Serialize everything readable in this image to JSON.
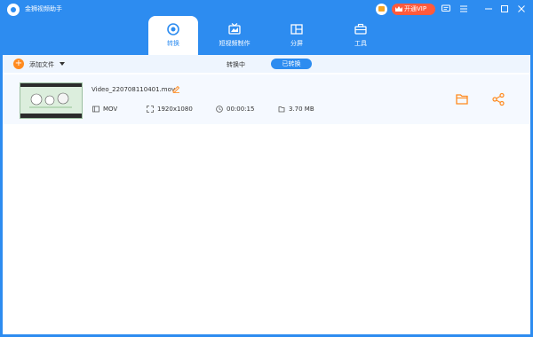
{
  "app": {
    "title": "金狮视频助手"
  },
  "titlebar": {
    "vip_label": "开通VIP",
    "icons": [
      "gift-icon",
      "crown-icon",
      "chat-icon",
      "menu-icon",
      "minimize-icon",
      "maximize-icon",
      "close-icon"
    ]
  },
  "tabs": [
    {
      "label": "转换",
      "icon": "convert-icon",
      "active": true
    },
    {
      "label": "短视频制作",
      "icon": "short-video-icon",
      "active": false
    },
    {
      "label": "分屏",
      "icon": "split-screen-icon",
      "active": false
    },
    {
      "label": "工具",
      "icon": "toolbox-icon",
      "active": false
    }
  ],
  "toolbar": {
    "add_label": "添加文件",
    "seg_converting": "转换中",
    "seg_done": "已转换"
  },
  "file": {
    "name": "Video_220708110401.mov",
    "format": "MOV",
    "resolution": "1920x1080",
    "duration": "00:00:15",
    "size": "3.70 MB"
  },
  "colors": {
    "accent": "#2d8cf0",
    "orange": "#ff8a1e",
    "vip": "#ff5a3c"
  }
}
